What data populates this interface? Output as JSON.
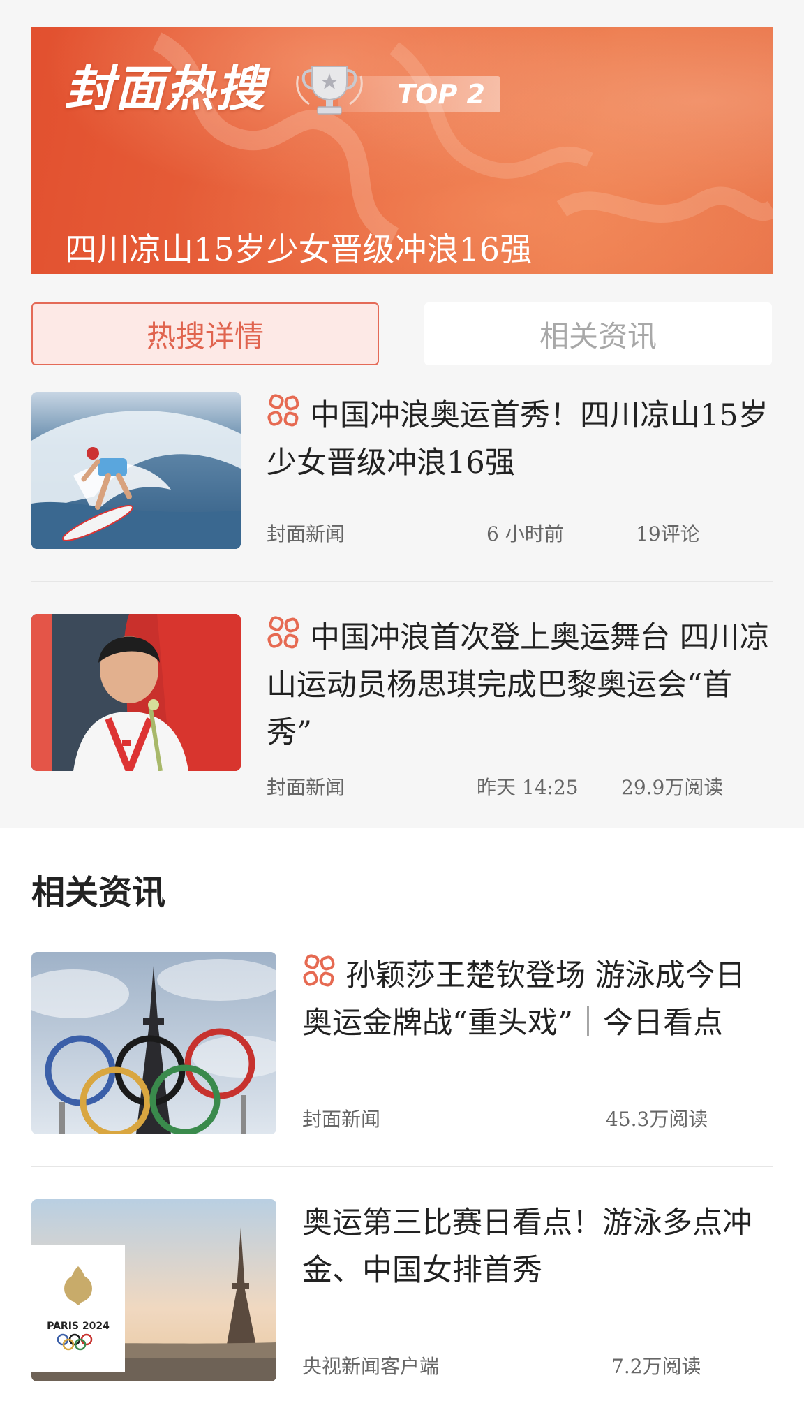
{
  "banner": {
    "title": "封面热搜",
    "rank_badge": "TOP 2",
    "headline": "四川凉山15岁少女晋级冲浪16强"
  },
  "tabs": [
    {
      "label": "热搜详情",
      "active": true
    },
    {
      "label": "相关资讯",
      "active": false
    }
  ],
  "hot_articles": [
    {
      "title": "中国冲浪奥运首秀！四川凉山15岁少女晋级冲浪16强",
      "source": "封面新闻",
      "time": "6 小时前",
      "stat": "19评论"
    },
    {
      "title": "中国冲浪首次登上奥运舞台 四川凉山运动员杨思琪完成巴黎奥运会“首秀”",
      "source": "封面新闻",
      "time": "昨天 14:25",
      "stat": "29.9万阅读"
    }
  ],
  "related": {
    "section_title": "相关资讯",
    "articles": [
      {
        "title": "孙颖莎王楚钦登场 游泳成今日奥运金牌战“重头戏”｜今日看点",
        "source": "封面新闻",
        "stat": "45.3万阅读"
      },
      {
        "title": "奥运第三比赛日看点！游泳多点冲金、中国女排首秀",
        "source": "央视新闻客户端",
        "stat": "7.2万阅读",
        "image_caption": "PARIS 2024"
      }
    ]
  },
  "colors": {
    "accent": "#e0644f",
    "banner": "#e2502f"
  }
}
